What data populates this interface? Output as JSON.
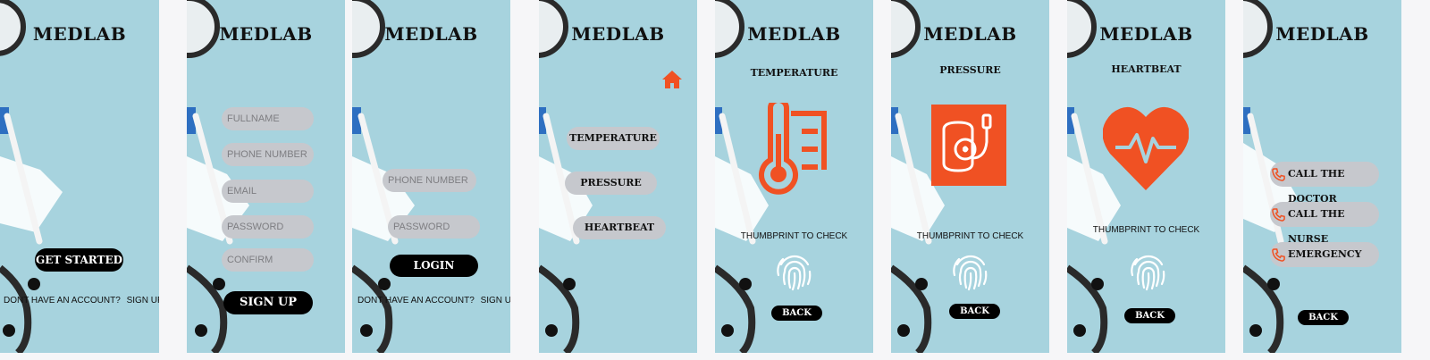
{
  "app_title": "MEDLAB",
  "accent": "#f05123",
  "screens": {
    "welcome": {
      "start_label": "GET STARTED",
      "account_prompt": "DONT HAVE AN ACCOUNT?",
      "signup_link": "SIGN UP"
    },
    "signup": {
      "fullname_placeholder": "FULLNAME",
      "phone_placeholder": "PHONE NUMBER",
      "email_placeholder": "EMAIL",
      "password_placeholder": "PASSWORD",
      "confirm_placeholder": "CONFIRM",
      "submit_label": "SIGN UP"
    },
    "login": {
      "phone_placeholder": "PHONE NUMBER",
      "password_placeholder": "PASSWORD",
      "submit_label": "LOGIN",
      "account_prompt": "DONT HAVE AN ACCOUNT?",
      "signup_link": "SIGN UP"
    },
    "menu": {
      "home_icon": "home-icon",
      "items": [
        "TEMPERATURE",
        "PRESSURE",
        "HEARTBEAT"
      ]
    },
    "temperature": {
      "title": "TEMPERATURE",
      "icon": "thermometer-icon",
      "check_label": "THUMBPRINT TO CHECK",
      "back_label": "BACK"
    },
    "pressure": {
      "title": "PRESSURE",
      "icon": "blood-pressure-icon",
      "check_label": "THUMBPRINT TO CHECK",
      "back_label": "BACK"
    },
    "heartbeat": {
      "title": "HEARTBEAT",
      "icon": "heart-pulse-icon",
      "check_label": "THUMBPRINT TO CHECK",
      "back_label": "BACK"
    },
    "contacts": {
      "items": [
        "CALL THE DOCTOR",
        "CALL THE NURSE",
        "EMERGENCY"
      ],
      "item_icon": "phone-icon",
      "back_label": "BACK"
    }
  }
}
